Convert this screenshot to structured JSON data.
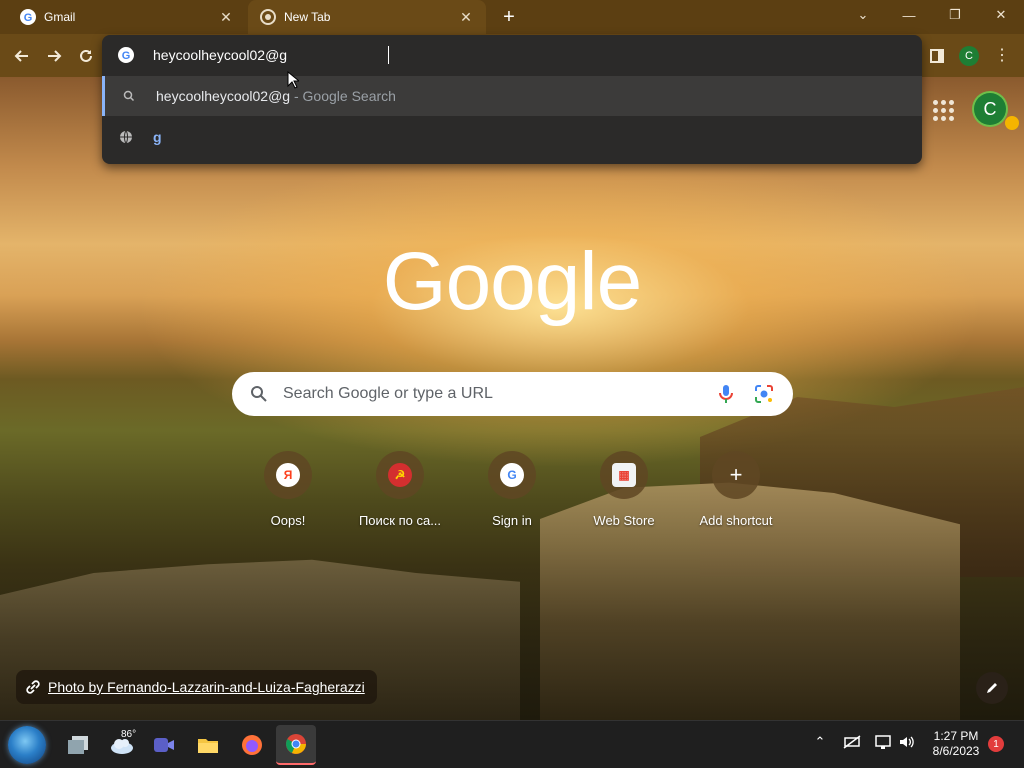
{
  "tabs": [
    {
      "title": "Gmail",
      "icon": "google-g-icon"
    },
    {
      "title": "New Tab",
      "icon": "chrome-icon"
    }
  ],
  "omnibox": {
    "value": "heycoolheycool02@g",
    "suggestions": [
      {
        "text": "heycoolheycool02@g",
        "sub": " - Google Search",
        "icon": "search-icon"
      },
      {
        "text": "g",
        "sub": "",
        "icon": "globe-icon"
      }
    ]
  },
  "profile": {
    "initial": "C"
  },
  "ntp": {
    "logo_text": "Google",
    "search_placeholder": "Search Google or type a URL",
    "shortcuts": [
      {
        "label": "Oops!",
        "glyph": "Я"
      },
      {
        "label": "Поиск по са...",
        "glyph": "☭"
      },
      {
        "label": "Sign in",
        "glyph": "G"
      },
      {
        "label": "Web Store",
        "glyph": "▦"
      },
      {
        "label": "Add shortcut",
        "glyph": "+"
      }
    ],
    "attribution": "Photo by Fernando-Lazzarin-and-Luiza-Fagherazzi"
  },
  "taskbar": {
    "weather_temp": "86°",
    "time": "1:27 PM",
    "date": "8/6/2023",
    "notification_count": "1"
  },
  "colors": {
    "accent": "#8ab4f8",
    "tabstrip": "#5c3f12",
    "toolbar": "#6a4a17"
  }
}
